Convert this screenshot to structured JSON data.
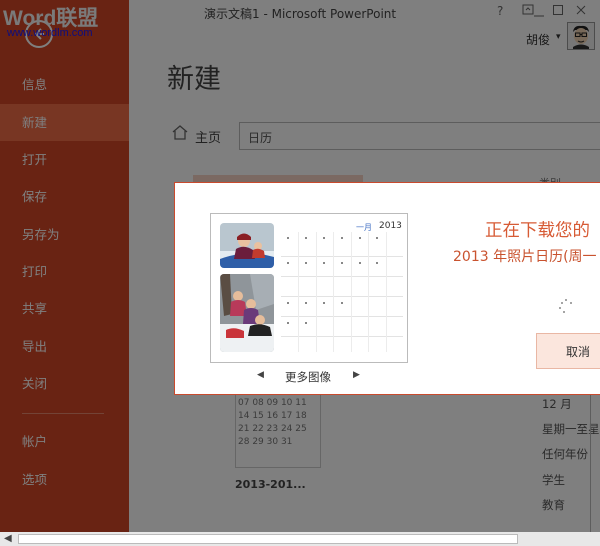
{
  "watermark": {
    "brand": "Word联盟",
    "url": "www.wordlm.com"
  },
  "window": {
    "title": "演示文稿1 - Microsoft PowerPoint",
    "help": "?",
    "user_name": "胡俊",
    "user_caret": "▾"
  },
  "sidebar": {
    "items": [
      {
        "label": "信息"
      },
      {
        "label": "新建"
      },
      {
        "label": "打开"
      },
      {
        "label": "保存"
      },
      {
        "label": "另存为"
      },
      {
        "label": "打印"
      },
      {
        "label": "共享"
      },
      {
        "label": "导出"
      },
      {
        "label": "关闭"
      },
      {
        "label": "帐户"
      },
      {
        "label": "选项"
      }
    ],
    "active_index": 1
  },
  "main": {
    "page_title": "新建",
    "home_label": "主页",
    "search_value": "日历",
    "template_name": "2013-201...",
    "mini_calendar_text": "07 08 09 10 11\n14 15 16 17 18\n21 22 23 24 25\n28 29 30 31",
    "category_top": "类别",
    "categories": [
      "12 月",
      "星期一至星",
      "任何年份",
      "学生",
      "教育"
    ]
  },
  "dialog": {
    "title": "正在下载您的",
    "subtitle": "2013 年照片日历(周一",
    "cancel_label": "取消",
    "preview": {
      "month": "一月",
      "year": "2013"
    },
    "pager_prev": "◀",
    "pager_label": "更多图像",
    "pager_next": "▶"
  },
  "colors": {
    "sidebar": "#d24726",
    "sidebar_active": "#f06c46",
    "accent_text": "#d75b35",
    "cancel_bg": "#fbe6dd"
  }
}
